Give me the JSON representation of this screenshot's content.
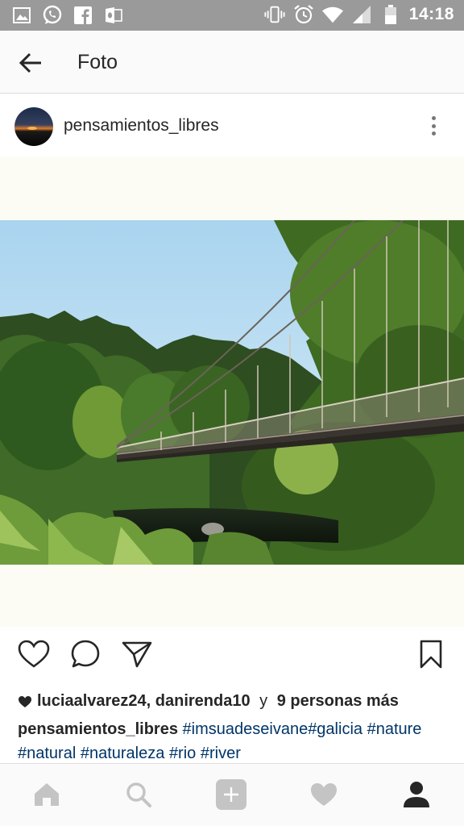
{
  "status_bar": {
    "time": "14:18",
    "left_icons": [
      "image-icon",
      "whatsapp-icon",
      "facebook-icon",
      "outlook-icon"
    ],
    "right_icons": [
      "vibrate-icon",
      "alarm-icon",
      "wifi-icon",
      "signal-icon",
      "battery-icon"
    ]
  },
  "app_bar": {
    "title": "Foto"
  },
  "post": {
    "username": "pensamientos_libres",
    "likes": {
      "users": "luciaalvarez24, danirenda10",
      "connector": " y ",
      "others": "9 personas más"
    },
    "caption": {
      "user": "pensamientos_libres",
      "tags": [
        "#imsuadeseivane",
        "#galicia",
        "#nature",
        "#natural",
        "#naturaleza",
        "#rio",
        "#river"
      ]
    }
  },
  "bottom_nav": {
    "items": [
      "home-icon",
      "search-icon",
      "add-icon",
      "activity-heart-icon",
      "profile-icon"
    ]
  }
}
